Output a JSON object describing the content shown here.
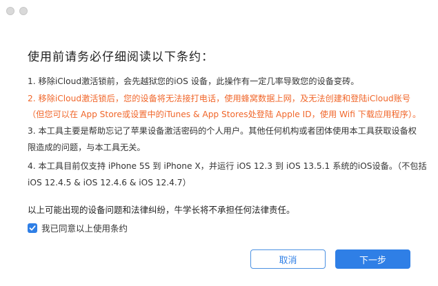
{
  "window": {
    "traffic_lights": [
      "close-dot",
      "minimize-dot"
    ]
  },
  "title": "使用前请务必仔细阅读以下条约：",
  "terms": [
    "1. 移除iCloud激活锁前，会先越狱您的iOS 设备，此操作有一定几率导致您的设备变砖。",
    "2. 移除iCloud激活锁后，您的设备将无法接打电话，使用蜂窝数据上网，及无法创建和登陆iCloud账号",
    "（但您可以在 App Store或设置中的iTunes & App Stores处登陆 Apple ID，使用 Wifi 下载应用程序）。",
    "3. 本工具主要是帮助忘记了苹果设备激活密码的个人用户。其他任何机构或者团体使用本工具获取设备权",
    "限造成的问题，与本工具无关。",
    "4. 本工具目前仅支持 iPhone 5S 到 iPhone X，并运行 iOS 12.3 到 iOS 13.5.1 系统的iOS设备。（不包括",
    "iOS 12.4.5 & iOS 12.4.6 & iOS 12.4.7）"
  ],
  "disclaimer": "以上可能出现的设备问题和法律纠纷，牛学长将不承担任何法律责任。",
  "agree": {
    "label": "我已同意以上使用条约",
    "checked": true,
    "icon": "checkmark-icon"
  },
  "buttons": {
    "cancel": "取消",
    "next": "下一步"
  },
  "colors": {
    "accent": "#2f7fe6",
    "warning": "#f0662a"
  }
}
